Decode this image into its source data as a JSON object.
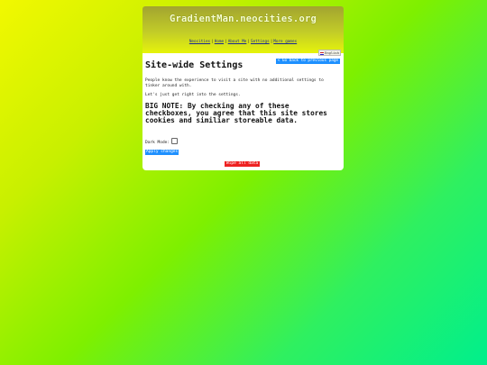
{
  "header": {
    "site_title": "GradientMan.neocities.org",
    "nav": [
      "Neocities",
      "Home",
      "About Me",
      "Settings",
      "More games"
    ]
  },
  "lang_button": {
    "label": "English"
  },
  "back_button": {
    "label": "< Go back to previous page"
  },
  "page": {
    "title": "Site-wide Settings",
    "intro": "People know the experience to visit a site with no additional settings to tinker around with.",
    "intro2": "Let's just get right into the settings.",
    "big_note": "BIG NOTE: By checking any of these checkboxes, you agree that this site stores cookies and similiar storeable data.",
    "dark_mode_label": "Dark Mode:",
    "dark_mode_checked": false,
    "apply_label": "Apply changes",
    "wipe_label": "Wipe all data"
  },
  "colors": {
    "button_blue": "#1e90ff",
    "button_red": "#ee2222",
    "link": "#1a2a90"
  }
}
